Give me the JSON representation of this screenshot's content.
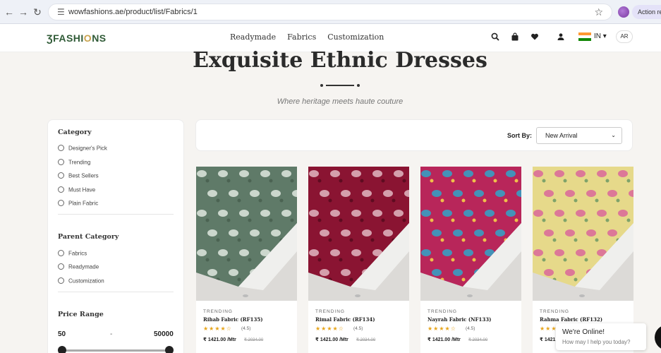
{
  "browser": {
    "url": "wowfashions.ae/product/list/Fabrics/1",
    "action_label": "Action re"
  },
  "header": {
    "logo_prefix": "Ʒ",
    "logo_text_a": "FASHI",
    "logo_o": "O",
    "logo_text_b": "NS",
    "nav": [
      "Readymade",
      "Fabrics",
      "Customization"
    ],
    "lang": "IN",
    "ar": "AR"
  },
  "hero": {
    "title": "Exquisite Ethnic Dresses",
    "subtitle": "Where heritage meets haute couture"
  },
  "sidebar": {
    "category_title": "Category",
    "categories": [
      "Designer's Pick",
      "Trending",
      "Best Sellers",
      "Must Have",
      "Plain Fabric"
    ],
    "parent_title": "Parent Category",
    "parents": [
      "Fabrics",
      "Readymade",
      "Customization"
    ],
    "price_title": "Price Range",
    "price_min": "50",
    "price_sep": "-",
    "price_max": "50000",
    "price_min_fraction": 0.0,
    "price_max_fraction": 1.0
  },
  "sort": {
    "label": "Sort By:",
    "value": "New Arrival"
  },
  "products": [
    {
      "badge": "TRENDING",
      "name": "Rihab Fabric (RF135)",
      "stars": "★★★★☆",
      "rating": "(4.5)",
      "price": "₹ 1421.00 /Mtr",
      "old_price": "₹ 2034.00",
      "colors": {
        "base": "#5f7a68",
        "pattern": "#dfe7df",
        "accent": "#4b6352"
      }
    },
    {
      "badge": "TRENDING",
      "name": "Rimal Fabric (RF134)",
      "stars": "★★★★☆",
      "rating": "(4.5)",
      "price": "₹ 1421.00 /Mtr",
      "old_price": "₹ 2034.00",
      "colors": {
        "base": "#8a1432",
        "pattern": "#e0b7c2",
        "accent": "#5e0b20"
      }
    },
    {
      "badge": "TRENDING",
      "name": "Nayrah Fabric (NF133)",
      "stars": "★★★★☆",
      "rating": "(4.5)",
      "price": "₹ 1421.00 /Mtr",
      "old_price": "₹ 2034.00",
      "colors": {
        "base": "#b8265a",
        "pattern": "#2fa6c9",
        "accent": "#f0c04a"
      }
    },
    {
      "badge": "TRENDING",
      "name": "Rahma Fabric (RF132)",
      "stars": "★★★★☆",
      "rating": "(4.5)",
      "price": "₹ 1421",
      "old_price": "",
      "colors": {
        "base": "#e6d98a",
        "pattern": "#d9669a",
        "accent": "#7fa36a"
      }
    }
  ],
  "chat": {
    "title": "We're Online!",
    "subtitle": "How may I help you today?"
  }
}
